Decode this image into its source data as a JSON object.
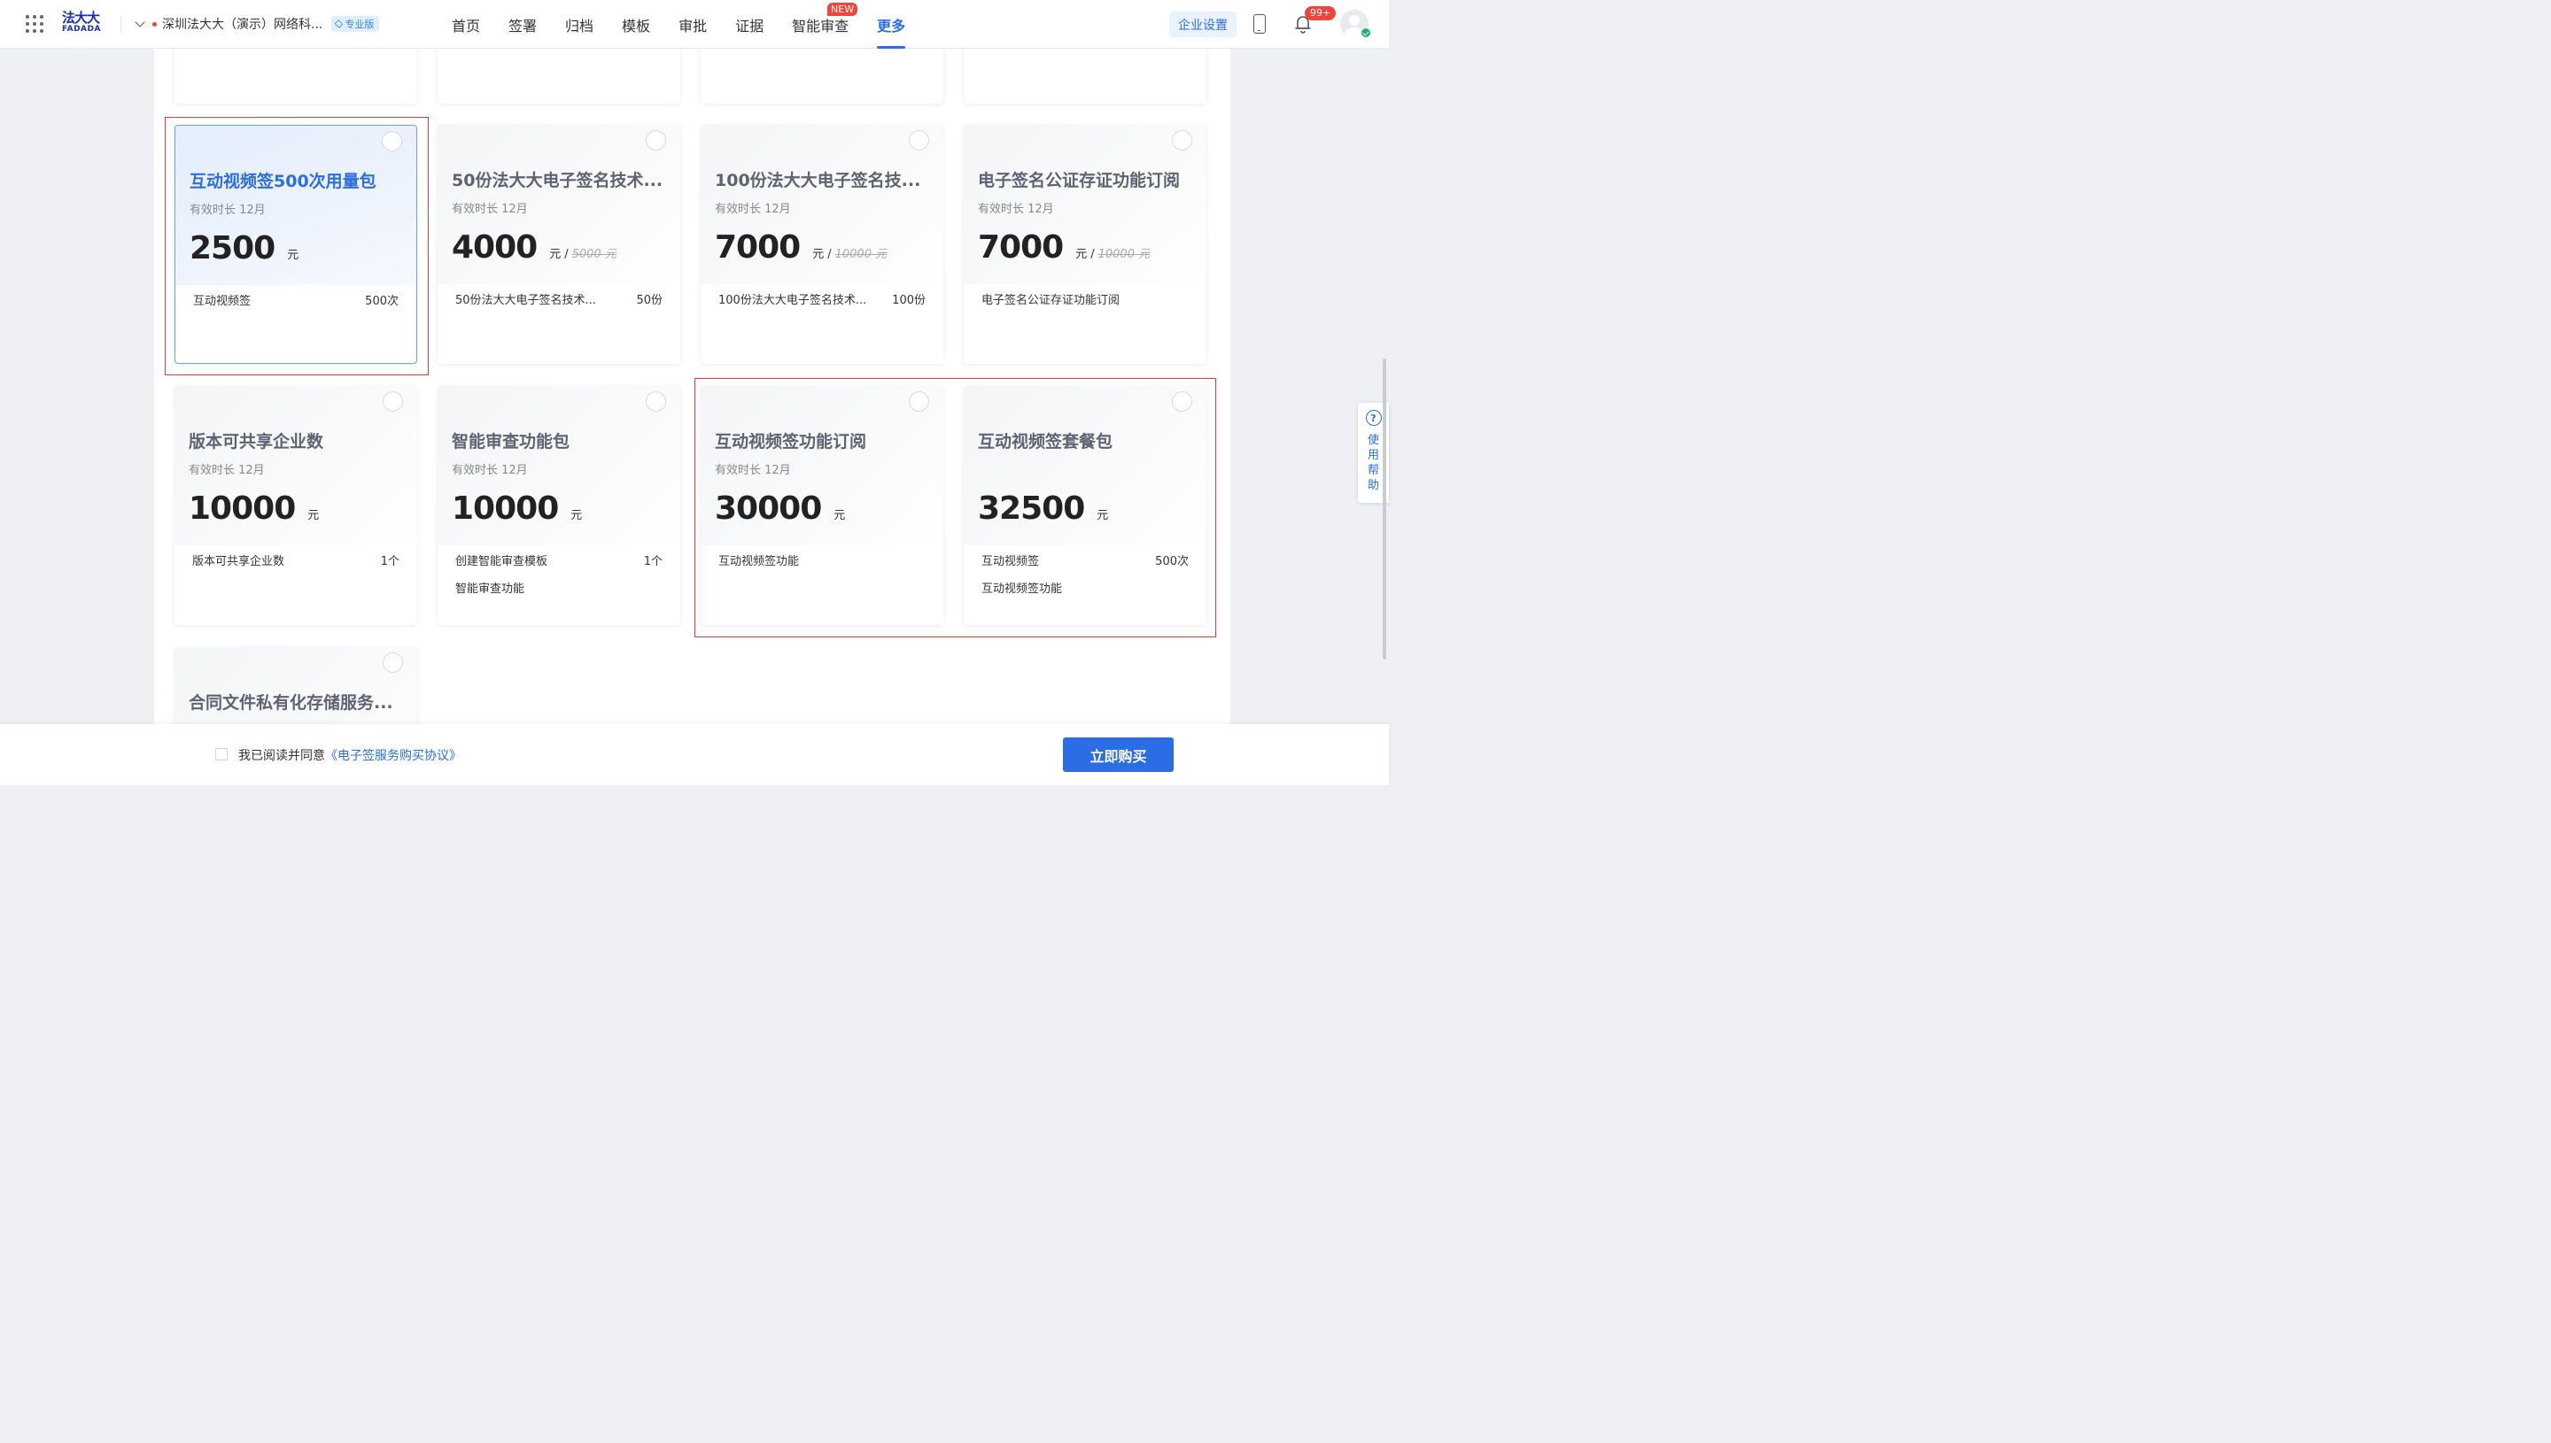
{
  "header": {
    "logo_cn": "法大大",
    "logo_en": "FADADA",
    "org_name": "深圳法大大（演示）网络科...",
    "edition_badge": "专业版",
    "nav": [
      {
        "label": "首页"
      },
      {
        "label": "签署"
      },
      {
        "label": "归档"
      },
      {
        "label": "模板"
      },
      {
        "label": "审批"
      },
      {
        "label": "证据"
      },
      {
        "label": "智能审查",
        "tag": "NEW"
      },
      {
        "label": "更多",
        "active": true
      }
    ],
    "corp_settings": "企业设置",
    "notif_count": "99+"
  },
  "cards": [
    {
      "title": "互动视频签500次用量包",
      "period": "有效时长 12月",
      "price": "2500",
      "unit": "元",
      "orig": "",
      "selected": true,
      "features": [
        {
          "name": "互动视频签",
          "qty": "500次"
        }
      ]
    },
    {
      "title": "50份法大大电子签名技术...",
      "period": "有效时长 12月",
      "price": "4000",
      "unit": "元",
      "orig": "5000 元",
      "features": [
        {
          "name": "50份法大大电子签名技术...",
          "qty": "50份"
        }
      ]
    },
    {
      "title": "100份法大大电子签名技...",
      "period": "有效时长 12月",
      "price": "7000",
      "unit": "元",
      "orig": "10000 元",
      "features": [
        {
          "name": "100份法大大电子签名技术...",
          "qty": "100份"
        }
      ]
    },
    {
      "title": "电子签名公证存证功能订阅",
      "period": "有效时长 12月",
      "price": "7000",
      "unit": "元",
      "orig": "10000 元",
      "features": [
        {
          "name": "电子签名公证存证功能订阅",
          "qty": ""
        }
      ]
    },
    {
      "title": "版本可共享企业数",
      "period": "有效时长 12月",
      "price": "10000",
      "unit": "元",
      "orig": "",
      "features": [
        {
          "name": "版本可共享企业数",
          "qty": "1个"
        }
      ]
    },
    {
      "title": "智能审查功能包",
      "period": "有效时长 12月",
      "price": "10000",
      "unit": "元",
      "orig": "",
      "features": [
        {
          "name": "创建智能审查模板",
          "qty": "1个"
        },
        {
          "name": "智能审查功能",
          "qty": ""
        }
      ]
    },
    {
      "title": "互动视频签功能订阅",
      "period": "有效时长 12月",
      "price": "30000",
      "unit": "元",
      "orig": "",
      "features": [
        {
          "name": "互动视频签功能",
          "qty": ""
        }
      ]
    },
    {
      "title": "互动视频签套餐包",
      "period": "",
      "price": "32500",
      "unit": "元",
      "orig": "",
      "features": [
        {
          "name": "互动视频签",
          "qty": "500次"
        },
        {
          "name": "互动视频签功能",
          "qty": ""
        }
      ]
    },
    {
      "title": "合同文件私有化存储服务...",
      "period": "",
      "price": "",
      "unit": "",
      "orig": "",
      "features": []
    }
  ],
  "help": {
    "label": "使用帮助",
    "icon": "?"
  },
  "footer": {
    "agree_prefix": "我已阅读并同意",
    "agree_link": "《电子签服务购买协议》",
    "buy_button": "立即购买"
  },
  "colors": {
    "primary": "#2b6de5",
    "highlight": "#e63b3b",
    "new_tag": "#f0453a"
  }
}
